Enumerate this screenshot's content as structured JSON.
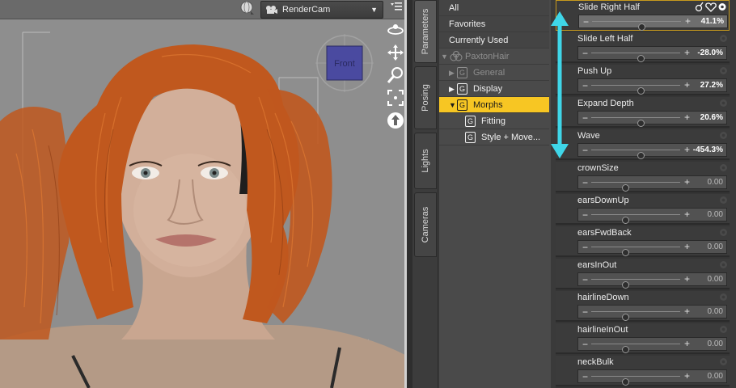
{
  "viewport": {
    "camera_label": "RenderCam",
    "cube_label": "Front"
  },
  "tabs": [
    "Parameters",
    "Posing",
    "Lights",
    "Cameras"
  ],
  "tree": {
    "top_items": [
      "All",
      "Favorites",
      "Currently Used"
    ],
    "figure": "PaxtonHair",
    "groups": [
      {
        "label": "General",
        "dim": true
      },
      {
        "label": "Display",
        "dim": false
      },
      {
        "label": "Morphs",
        "selected": true
      }
    ],
    "children": [
      "Fitting",
      "Style + Move..."
    ]
  },
  "params": [
    {
      "name": "Slide Right Half",
      "value": "41.1%",
      "level": 0.55
    },
    {
      "name": "Slide Left Half",
      "value": "-28.0%",
      "level": 0.55
    },
    {
      "name": "Push Up",
      "value": "27.2%",
      "level": 0.55
    },
    {
      "name": "Expand Depth",
      "value": "20.6%",
      "level": 0.55
    },
    {
      "name": "Wave",
      "value": "-454.3%",
      "level": 0.55
    },
    {
      "name": "crownSize",
      "value": "0.00",
      "level": 0.38
    },
    {
      "name": "earsDownUp",
      "value": "0.00",
      "level": 0.38
    },
    {
      "name": "earsFwdBack",
      "value": "0.00",
      "level": 0.38
    },
    {
      "name": "earsInOut",
      "value": "0.00",
      "level": 0.38
    },
    {
      "name": "hairlineDown",
      "value": "0.00",
      "level": 0.38
    },
    {
      "name": "hairlineInOut",
      "value": "0.00",
      "level": 0.38
    },
    {
      "name": "neckBulk",
      "value": "0.00",
      "level": 0.38
    }
  ],
  "colors": {
    "selection": "#f7c623",
    "annotation_arrow": "#3fd6e8",
    "cube": "#4a4aa0"
  }
}
